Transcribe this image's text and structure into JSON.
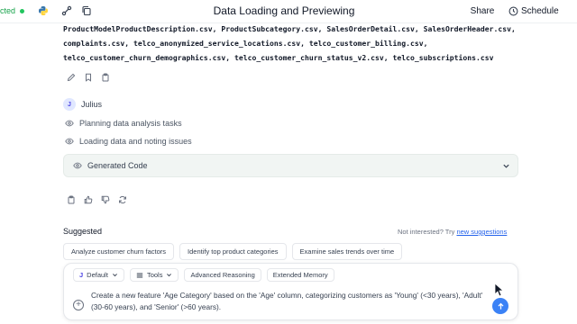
{
  "header": {
    "status_text": "cted",
    "title": "Data Loading and Previewing",
    "share_label": "Share",
    "schedule_label": "Schedule",
    "status_color": "#22c55e",
    "icons": [
      "python-icon",
      "share-network-icon",
      "copy-icon",
      "clock-icon"
    ]
  },
  "files": {
    "lines": [
      "ProductModelProductDescription.csv, ProductSubcategory.csv, SalesOrderDetail.csv, SalesOrderHeader.csv,",
      "complaints.csv, telco_anonymized_service_locations.csv, telco_customer_billing.csv,",
      "telco_customer_churn_demographics.csv, telco_customer_churn_status_v2.csv, telco_subscriptions.csv"
    ]
  },
  "message_actions": [
    "edit-icon",
    "bookmark-icon",
    "clipboard-icon"
  ],
  "assistant": {
    "avatar_letter": "J",
    "name": "Julius",
    "steps": [
      "Planning data analysis tasks",
      "Loading data and noting issues"
    ],
    "generated_code_label": "Generated Code"
  },
  "response_actions": [
    "clipboard-icon",
    "thumbs-up-icon",
    "thumbs-down-icon",
    "refresh-icon"
  ],
  "suggested": {
    "label": "Suggested",
    "not_interested_prefix": "Not interested? Try",
    "new_suggestions_link": "new suggestions",
    "chips": [
      "Analyze customer churn factors",
      "Identify top product categories",
      "Examine sales trends over time"
    ]
  },
  "composer": {
    "model_mark": "J",
    "model_label": "Default",
    "tools_label": "Tools",
    "reasoning_label": "Advanced Reasoning",
    "memory_label": "Extended Memory",
    "prompt_text": "Create a new feature 'Age Category' based on the 'Age' column, categorizing customers as 'Young' (<30 years), 'Adult' (30-60 years), and 'Senior' (>60 years).",
    "send_color": "#3b82f6"
  }
}
